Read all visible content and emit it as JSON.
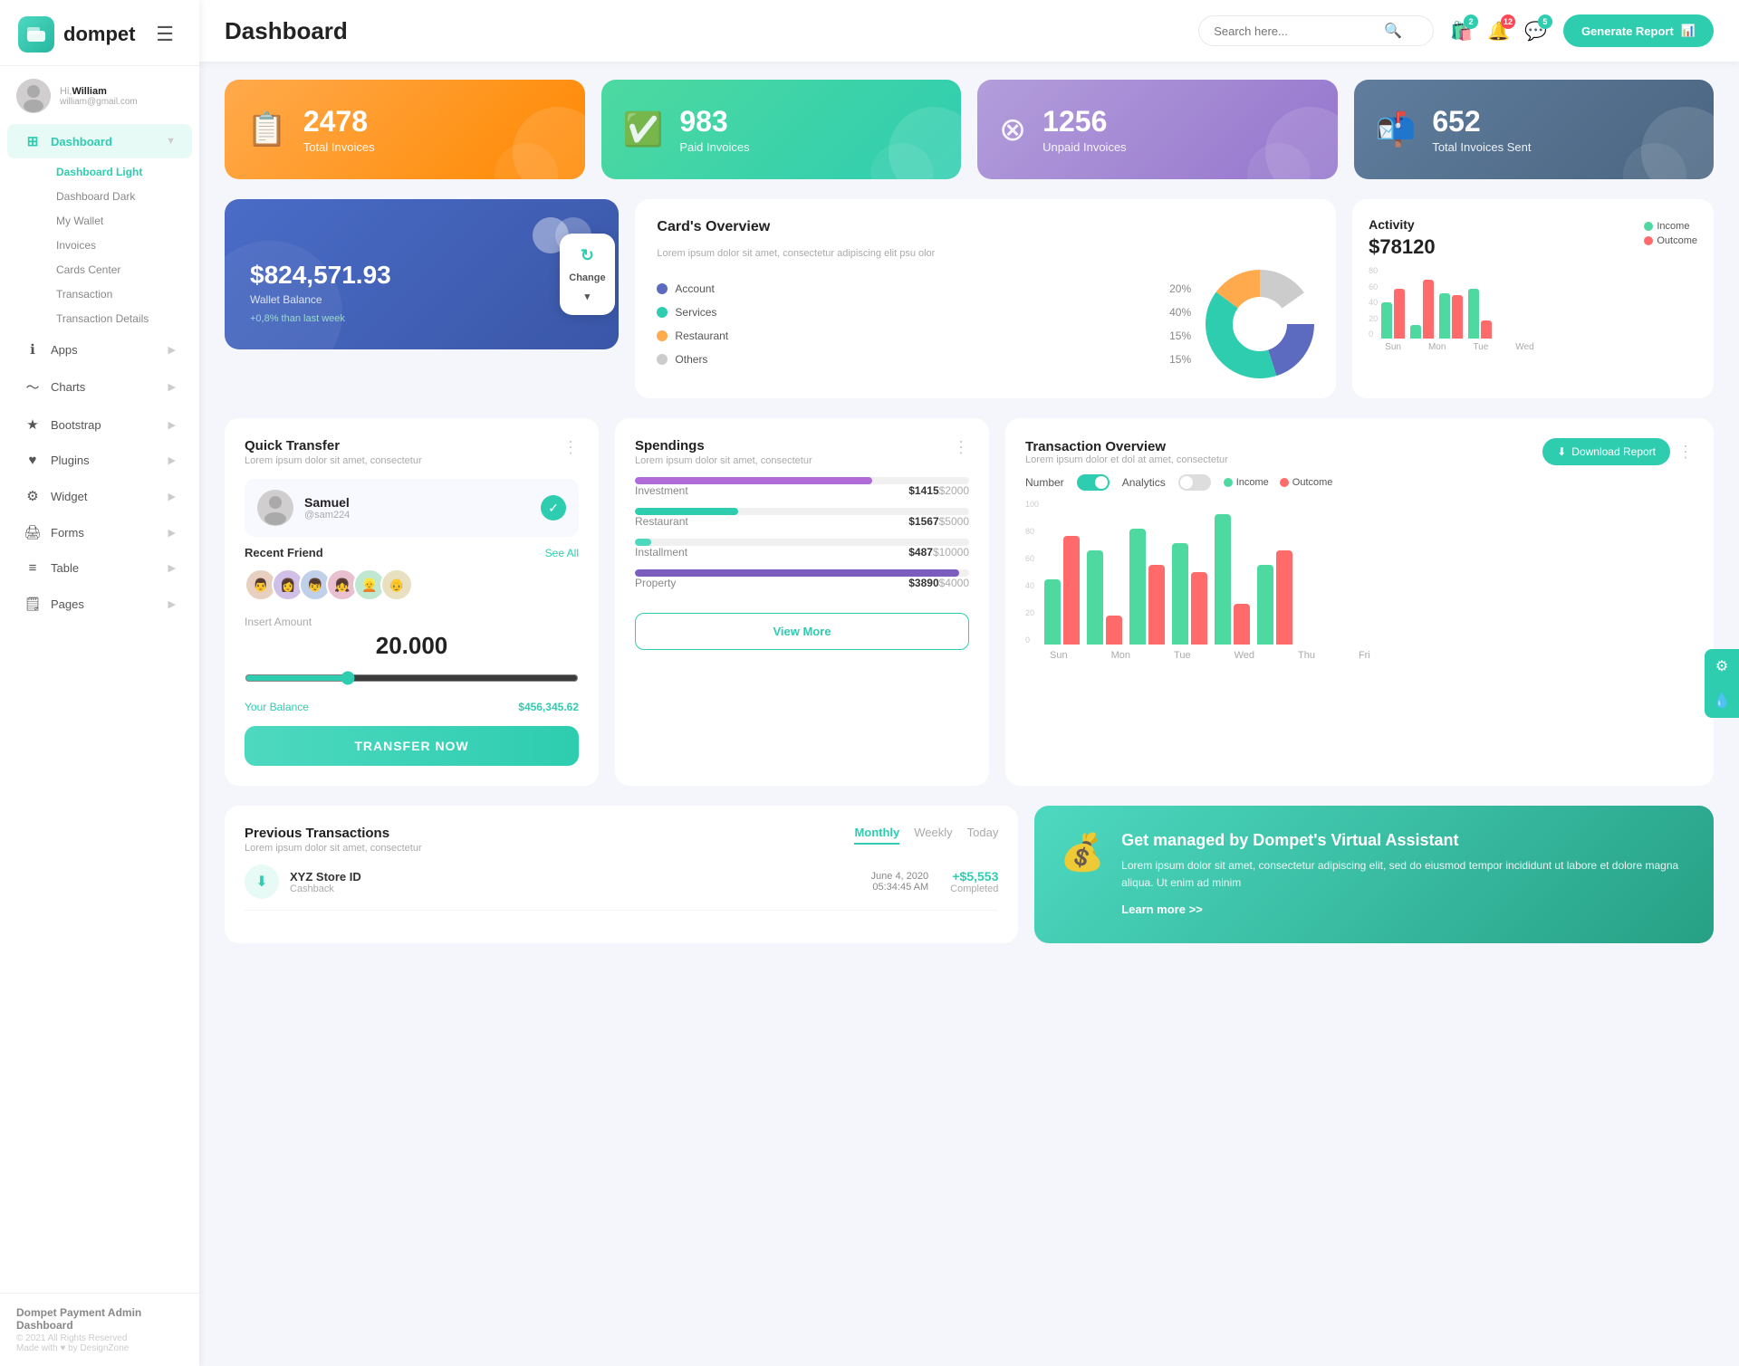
{
  "app": {
    "logo": "dompet",
    "logo_icon": "💳"
  },
  "header": {
    "page_title": "Dashboard",
    "search_placeholder": "Search here...",
    "notifications": [
      {
        "icon": "🛍️",
        "badge": 2,
        "badge_color": "teal"
      },
      {
        "icon": "🔔",
        "badge": 12,
        "badge_color": "red"
      },
      {
        "icon": "💬",
        "badge": 5,
        "badge_color": "teal"
      }
    ],
    "generate_btn": "Generate Report"
  },
  "user": {
    "greeting": "Hi,",
    "name": "William",
    "email": "william@gmail.com"
  },
  "sidebar": {
    "menu_icon": "☰",
    "nav_items": [
      {
        "label": "Dashboard",
        "icon": "⊞",
        "active": true,
        "has_arrow": true,
        "has_sub": true
      },
      {
        "label": "Apps",
        "icon": "ℹ",
        "active": false,
        "has_arrow": true
      },
      {
        "label": "Charts",
        "icon": "〜",
        "active": false,
        "has_arrow": true
      },
      {
        "label": "Bootstrap",
        "icon": "★",
        "active": false,
        "has_arrow": true
      },
      {
        "label": "Plugins",
        "icon": "♥",
        "active": false,
        "has_arrow": true
      },
      {
        "label": "Widget",
        "icon": "⚙",
        "active": false,
        "has_arrow": true
      },
      {
        "label": "Forms",
        "icon": "🖨",
        "active": false,
        "has_arrow": true
      },
      {
        "label": "Table",
        "icon": "≡",
        "active": false,
        "has_arrow": true
      },
      {
        "label": "Pages",
        "icon": "🗒",
        "active": false,
        "has_arrow": true
      }
    ],
    "sub_items": [
      {
        "label": "Dashboard Light",
        "active": true
      },
      {
        "label": "Dashboard Dark",
        "active": false
      },
      {
        "label": "My Wallet",
        "active": false
      },
      {
        "label": "Invoices",
        "active": false
      },
      {
        "label": "Cards Center",
        "active": false
      },
      {
        "label": "Transaction",
        "active": false
      },
      {
        "label": "Transaction Details",
        "active": false
      }
    ],
    "footer_brand": "Dompet Payment Admin Dashboard",
    "footer_year": "© 2021 All Rights Reserved",
    "footer_made": "Made with ♥ by DesignZone"
  },
  "stat_cards": [
    {
      "number": "2478",
      "label": "Total Invoices",
      "icon": "📋",
      "color": "orange"
    },
    {
      "number": "983",
      "label": "Paid Invoices",
      "icon": "✅",
      "color": "green"
    },
    {
      "number": "1256",
      "label": "Unpaid Invoices",
      "icon": "⊗",
      "color": "purple"
    },
    {
      "number": "652",
      "label": "Total Invoices Sent",
      "icon": "📬",
      "color": "teal"
    }
  ],
  "wallet": {
    "amount": "$824,571.93",
    "label": "Wallet Balance",
    "change": "+0,8% than last week",
    "change_btn": "Change"
  },
  "cards_overview": {
    "title": "Card's Overview",
    "subtitle": "Lorem ipsum dolor sit amet, consectetur adipiscing elit psu olor",
    "items": [
      {
        "label": "Account",
        "pct": "20%",
        "color": "#5c6bc0"
      },
      {
        "label": "Services",
        "pct": "40%",
        "color": "#2ecdb0"
      },
      {
        "label": "Restaurant",
        "pct": "15%",
        "color": "#ffaa4c"
      },
      {
        "label": "Others",
        "pct": "15%",
        "color": "#ccc"
      }
    ]
  },
  "activity": {
    "title": "Activity",
    "amount": "$78120",
    "legend": [
      {
        "label": "Income",
        "color": "#4dd9a0"
      },
      {
        "label": "Outcome",
        "color": "#ff6b6b"
      }
    ],
    "bars": [
      {
        "label": "Sun",
        "income": 40,
        "outcome": 55
      },
      {
        "label": "Mon",
        "income": 15,
        "outcome": 65
      },
      {
        "label": "Tue",
        "income": 50,
        "outcome": 48
      },
      {
        "label": "Wed",
        "income": 55,
        "outcome": 20
      }
    ],
    "y_axis": [
      80,
      60,
      40,
      20,
      0
    ]
  },
  "quick_transfer": {
    "title": "Quick Transfer",
    "subtitle": "Lorem ipsum dolor sit amet, consectetur",
    "user": {
      "name": "Samuel",
      "handle": "@sam224"
    },
    "recent_label": "Recent Friend",
    "see_all": "See All",
    "friends": [
      "👨",
      "👩",
      "👦",
      "👧",
      "👱",
      "👴"
    ],
    "amount_label": "Insert Amount",
    "amount_value": "20.000",
    "balance_label": "Your Balance",
    "balance_value": "$456,345.62",
    "transfer_btn": "TRANSFER NOW",
    "slider_value": 30
  },
  "spendings": {
    "title": "Spendings",
    "subtitle": "Lorem ipsum dolor sit amet, consectetur",
    "items": [
      {
        "label": "Investment",
        "amount": "$1415",
        "total": "$2000",
        "pct": 71,
        "color": "#b06bd9"
      },
      {
        "label": "Restaurant",
        "amount": "$1567",
        "total": "$5000",
        "pct": 31,
        "color": "#2ecdb0"
      },
      {
        "label": "Installment",
        "amount": "$487",
        "total": "$10000",
        "pct": 5,
        "color": "#4dd9c0"
      },
      {
        "label": "Property",
        "amount": "$3890",
        "total": "$4000",
        "pct": 97,
        "color": "#7c5cbf"
      }
    ],
    "view_more_btn": "View More"
  },
  "transaction_overview": {
    "title": "Transaction Overview",
    "subtitle": "Lorem ipsum dolor et dol at amet, consectetur",
    "download_btn": "Download Report",
    "toggle_number": "Number",
    "toggle_analytics": "Analytics",
    "legend": [
      {
        "label": "Income",
        "color": "#4dd9a0"
      },
      {
        "label": "Outcome",
        "color": "#ff6b6b"
      }
    ],
    "bars": [
      {
        "label": "Sun",
        "income": 45,
        "outcome": 75
      },
      {
        "label": "Mon",
        "income": 65,
        "outcome": 20
      },
      {
        "label": "Tue",
        "income": 80,
        "outcome": 55
      },
      {
        "label": "Wed",
        "income": 70,
        "outcome": 50
      },
      {
        "label": "Thu",
        "income": 90,
        "outcome": 28
      },
      {
        "label": "Fri",
        "income": 55,
        "outcome": 65
      }
    ],
    "y_axis": [
      100,
      80,
      60,
      40,
      20,
      0
    ]
  },
  "previous_transactions": {
    "title": "Previous Transactions",
    "subtitle": "Lorem ipsum dolor sit amet, consectetur",
    "tabs": [
      "Monthly",
      "Weekly",
      "Today"
    ],
    "active_tab": "Monthly",
    "items": [
      {
        "name": "XYZ Store ID",
        "type": "Cashback",
        "date": "June 4, 2020",
        "time": "05:34:45 AM",
        "amount": "+$5,553",
        "status": "Completed",
        "icon": "⬇️"
      }
    ]
  },
  "virtual_assistant": {
    "title": "Get managed by Dompet's Virtual Assistant",
    "text": "Lorem ipsum dolor sit amet, consectetur adipiscing elit, sed do eiusmod tempor incididunt ut labore et dolore magna aliqua. Ut enim ad minim",
    "link": "Learn more >>"
  },
  "floating": [
    {
      "icon": "⚙️"
    },
    {
      "icon": "💧"
    }
  ]
}
